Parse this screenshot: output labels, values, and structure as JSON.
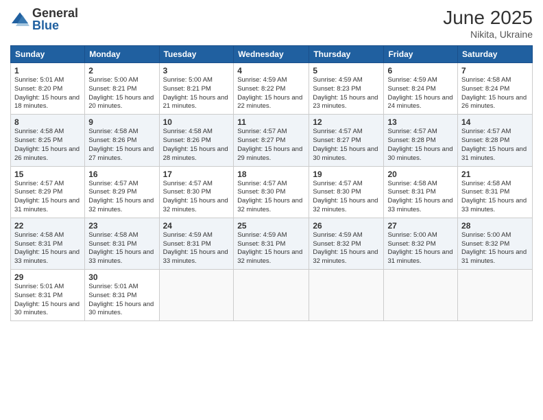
{
  "header": {
    "logo_general": "General",
    "logo_blue": "Blue",
    "month_year": "June 2025",
    "location": "Nikita, Ukraine"
  },
  "weekdays": [
    "Sunday",
    "Monday",
    "Tuesday",
    "Wednesday",
    "Thursday",
    "Friday",
    "Saturday"
  ],
  "weeks": [
    [
      {
        "day": "1",
        "sunrise": "5:01 AM",
        "sunset": "8:20 PM",
        "daylight": "15 hours and 18 minutes."
      },
      {
        "day": "2",
        "sunrise": "5:00 AM",
        "sunset": "8:21 PM",
        "daylight": "15 hours and 20 minutes."
      },
      {
        "day": "3",
        "sunrise": "5:00 AM",
        "sunset": "8:21 PM",
        "daylight": "15 hours and 21 minutes."
      },
      {
        "day": "4",
        "sunrise": "4:59 AM",
        "sunset": "8:22 PM",
        "daylight": "15 hours and 22 minutes."
      },
      {
        "day": "5",
        "sunrise": "4:59 AM",
        "sunset": "8:23 PM",
        "daylight": "15 hours and 23 minutes."
      },
      {
        "day": "6",
        "sunrise": "4:59 AM",
        "sunset": "8:24 PM",
        "daylight": "15 hours and 24 minutes."
      },
      {
        "day": "7",
        "sunrise": "4:58 AM",
        "sunset": "8:24 PM",
        "daylight": "15 hours and 26 minutes."
      }
    ],
    [
      {
        "day": "8",
        "sunrise": "4:58 AM",
        "sunset": "8:25 PM",
        "daylight": "15 hours and 26 minutes."
      },
      {
        "day": "9",
        "sunrise": "4:58 AM",
        "sunset": "8:26 PM",
        "daylight": "15 hours and 27 minutes."
      },
      {
        "day": "10",
        "sunrise": "4:58 AM",
        "sunset": "8:26 PM",
        "daylight": "15 hours and 28 minutes."
      },
      {
        "day": "11",
        "sunrise": "4:57 AM",
        "sunset": "8:27 PM",
        "daylight": "15 hours and 29 minutes."
      },
      {
        "day": "12",
        "sunrise": "4:57 AM",
        "sunset": "8:27 PM",
        "daylight": "15 hours and 30 minutes."
      },
      {
        "day": "13",
        "sunrise": "4:57 AM",
        "sunset": "8:28 PM",
        "daylight": "15 hours and 30 minutes."
      },
      {
        "day": "14",
        "sunrise": "4:57 AM",
        "sunset": "8:28 PM",
        "daylight": "15 hours and 31 minutes."
      }
    ],
    [
      {
        "day": "15",
        "sunrise": "4:57 AM",
        "sunset": "8:29 PM",
        "daylight": "15 hours and 31 minutes."
      },
      {
        "day": "16",
        "sunrise": "4:57 AM",
        "sunset": "8:29 PM",
        "daylight": "15 hours and 32 minutes."
      },
      {
        "day": "17",
        "sunrise": "4:57 AM",
        "sunset": "8:30 PM",
        "daylight": "15 hours and 32 minutes."
      },
      {
        "day": "18",
        "sunrise": "4:57 AM",
        "sunset": "8:30 PM",
        "daylight": "15 hours and 32 minutes."
      },
      {
        "day": "19",
        "sunrise": "4:57 AM",
        "sunset": "8:30 PM",
        "daylight": "15 hours and 32 minutes."
      },
      {
        "day": "20",
        "sunrise": "4:58 AM",
        "sunset": "8:31 PM",
        "daylight": "15 hours and 33 minutes."
      },
      {
        "day": "21",
        "sunrise": "4:58 AM",
        "sunset": "8:31 PM",
        "daylight": "15 hours and 33 minutes."
      }
    ],
    [
      {
        "day": "22",
        "sunrise": "4:58 AM",
        "sunset": "8:31 PM",
        "daylight": "15 hours and 33 minutes."
      },
      {
        "day": "23",
        "sunrise": "4:58 AM",
        "sunset": "8:31 PM",
        "daylight": "15 hours and 33 minutes."
      },
      {
        "day": "24",
        "sunrise": "4:59 AM",
        "sunset": "8:31 PM",
        "daylight": "15 hours and 33 minutes."
      },
      {
        "day": "25",
        "sunrise": "4:59 AM",
        "sunset": "8:31 PM",
        "daylight": "15 hours and 32 minutes."
      },
      {
        "day": "26",
        "sunrise": "4:59 AM",
        "sunset": "8:32 PM",
        "daylight": "15 hours and 32 minutes."
      },
      {
        "day": "27",
        "sunrise": "5:00 AM",
        "sunset": "8:32 PM",
        "daylight": "15 hours and 31 minutes."
      },
      {
        "day": "28",
        "sunrise": "5:00 AM",
        "sunset": "8:32 PM",
        "daylight": "15 hours and 31 minutes."
      }
    ],
    [
      {
        "day": "29",
        "sunrise": "5:01 AM",
        "sunset": "8:31 PM",
        "daylight": "15 hours and 30 minutes."
      },
      {
        "day": "30",
        "sunrise": "5:01 AM",
        "sunset": "8:31 PM",
        "daylight": "15 hours and 30 minutes."
      },
      null,
      null,
      null,
      null,
      null
    ]
  ]
}
